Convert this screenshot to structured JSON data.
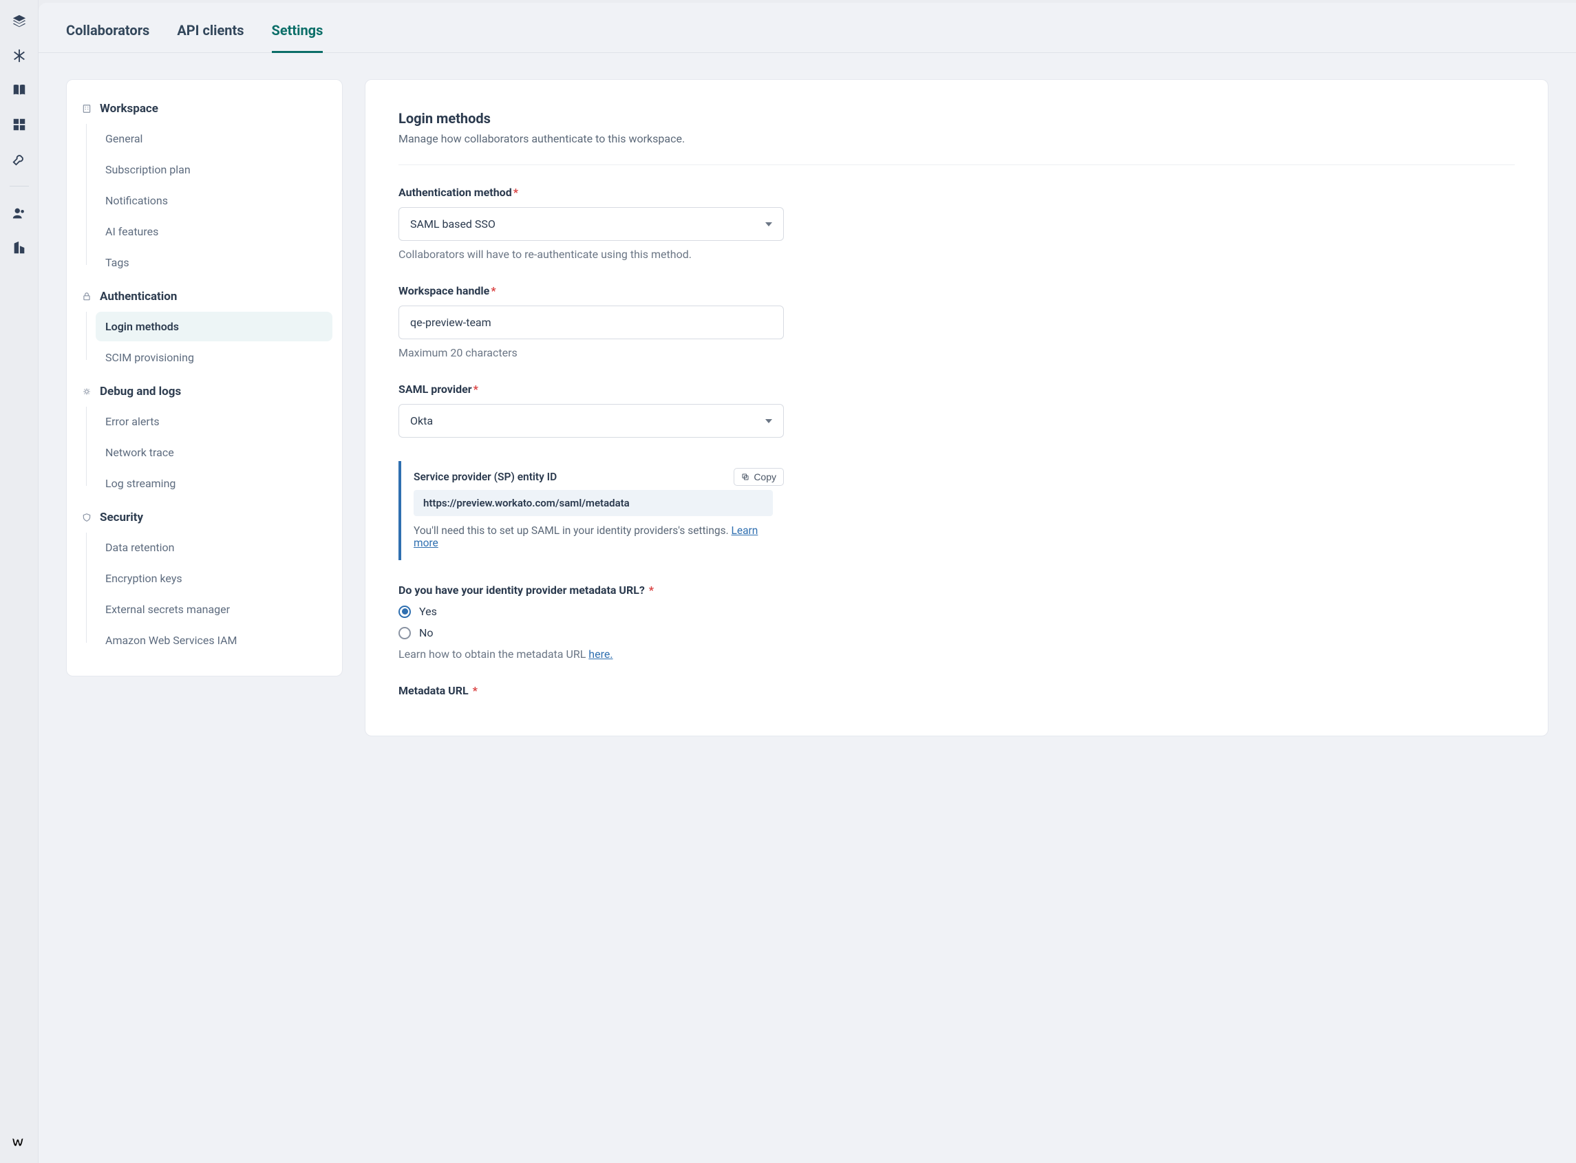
{
  "tabs": {
    "collaborators": "Collaborators",
    "api_clients": "API clients",
    "settings": "Settings"
  },
  "sidebar": {
    "groups": [
      {
        "heading": "Workspace",
        "items": [
          "General",
          "Subscription plan",
          "Notifications",
          "AI features",
          "Tags"
        ]
      },
      {
        "heading": "Authentication",
        "items": [
          "Login methods",
          "SCIM provisioning"
        ]
      },
      {
        "heading": "Debug and logs",
        "items": [
          "Error alerts",
          "Network trace",
          "Log streaming"
        ]
      },
      {
        "heading": "Security",
        "items": [
          "Data retention",
          "Encryption keys",
          "External secrets manager",
          "Amazon Web Services IAM"
        ]
      }
    ],
    "active_item": "Login methods"
  },
  "main": {
    "title": "Login methods",
    "subtitle": "Manage how collaborators authenticate to this workspace.",
    "auth_method": {
      "label": "Authentication method",
      "value": "SAML based SSO",
      "helper": "Collaborators will have to re-authenticate using this method."
    },
    "workspace_handle": {
      "label": "Workspace handle",
      "value": "qe-preview-team",
      "helper": "Maximum 20 characters"
    },
    "saml_provider": {
      "label": "SAML provider",
      "value": "Okta"
    },
    "sp_info": {
      "title": "Service provider (SP) entity ID",
      "url": "https://preview.workato.com/saml/metadata",
      "help_text": "You'll need this to set up SAML in your identity providers's settings. ",
      "learn_more": "Learn more",
      "copy_label": "Copy"
    },
    "metadata_q": {
      "label": "Do you have your identity provider metadata URL?",
      "yes": "Yes",
      "no": "No",
      "selected": "yes",
      "help_text": "Learn how to obtain the metadata URL ",
      "help_link": "here."
    },
    "metadata_url": {
      "label": "Metadata URL"
    }
  }
}
